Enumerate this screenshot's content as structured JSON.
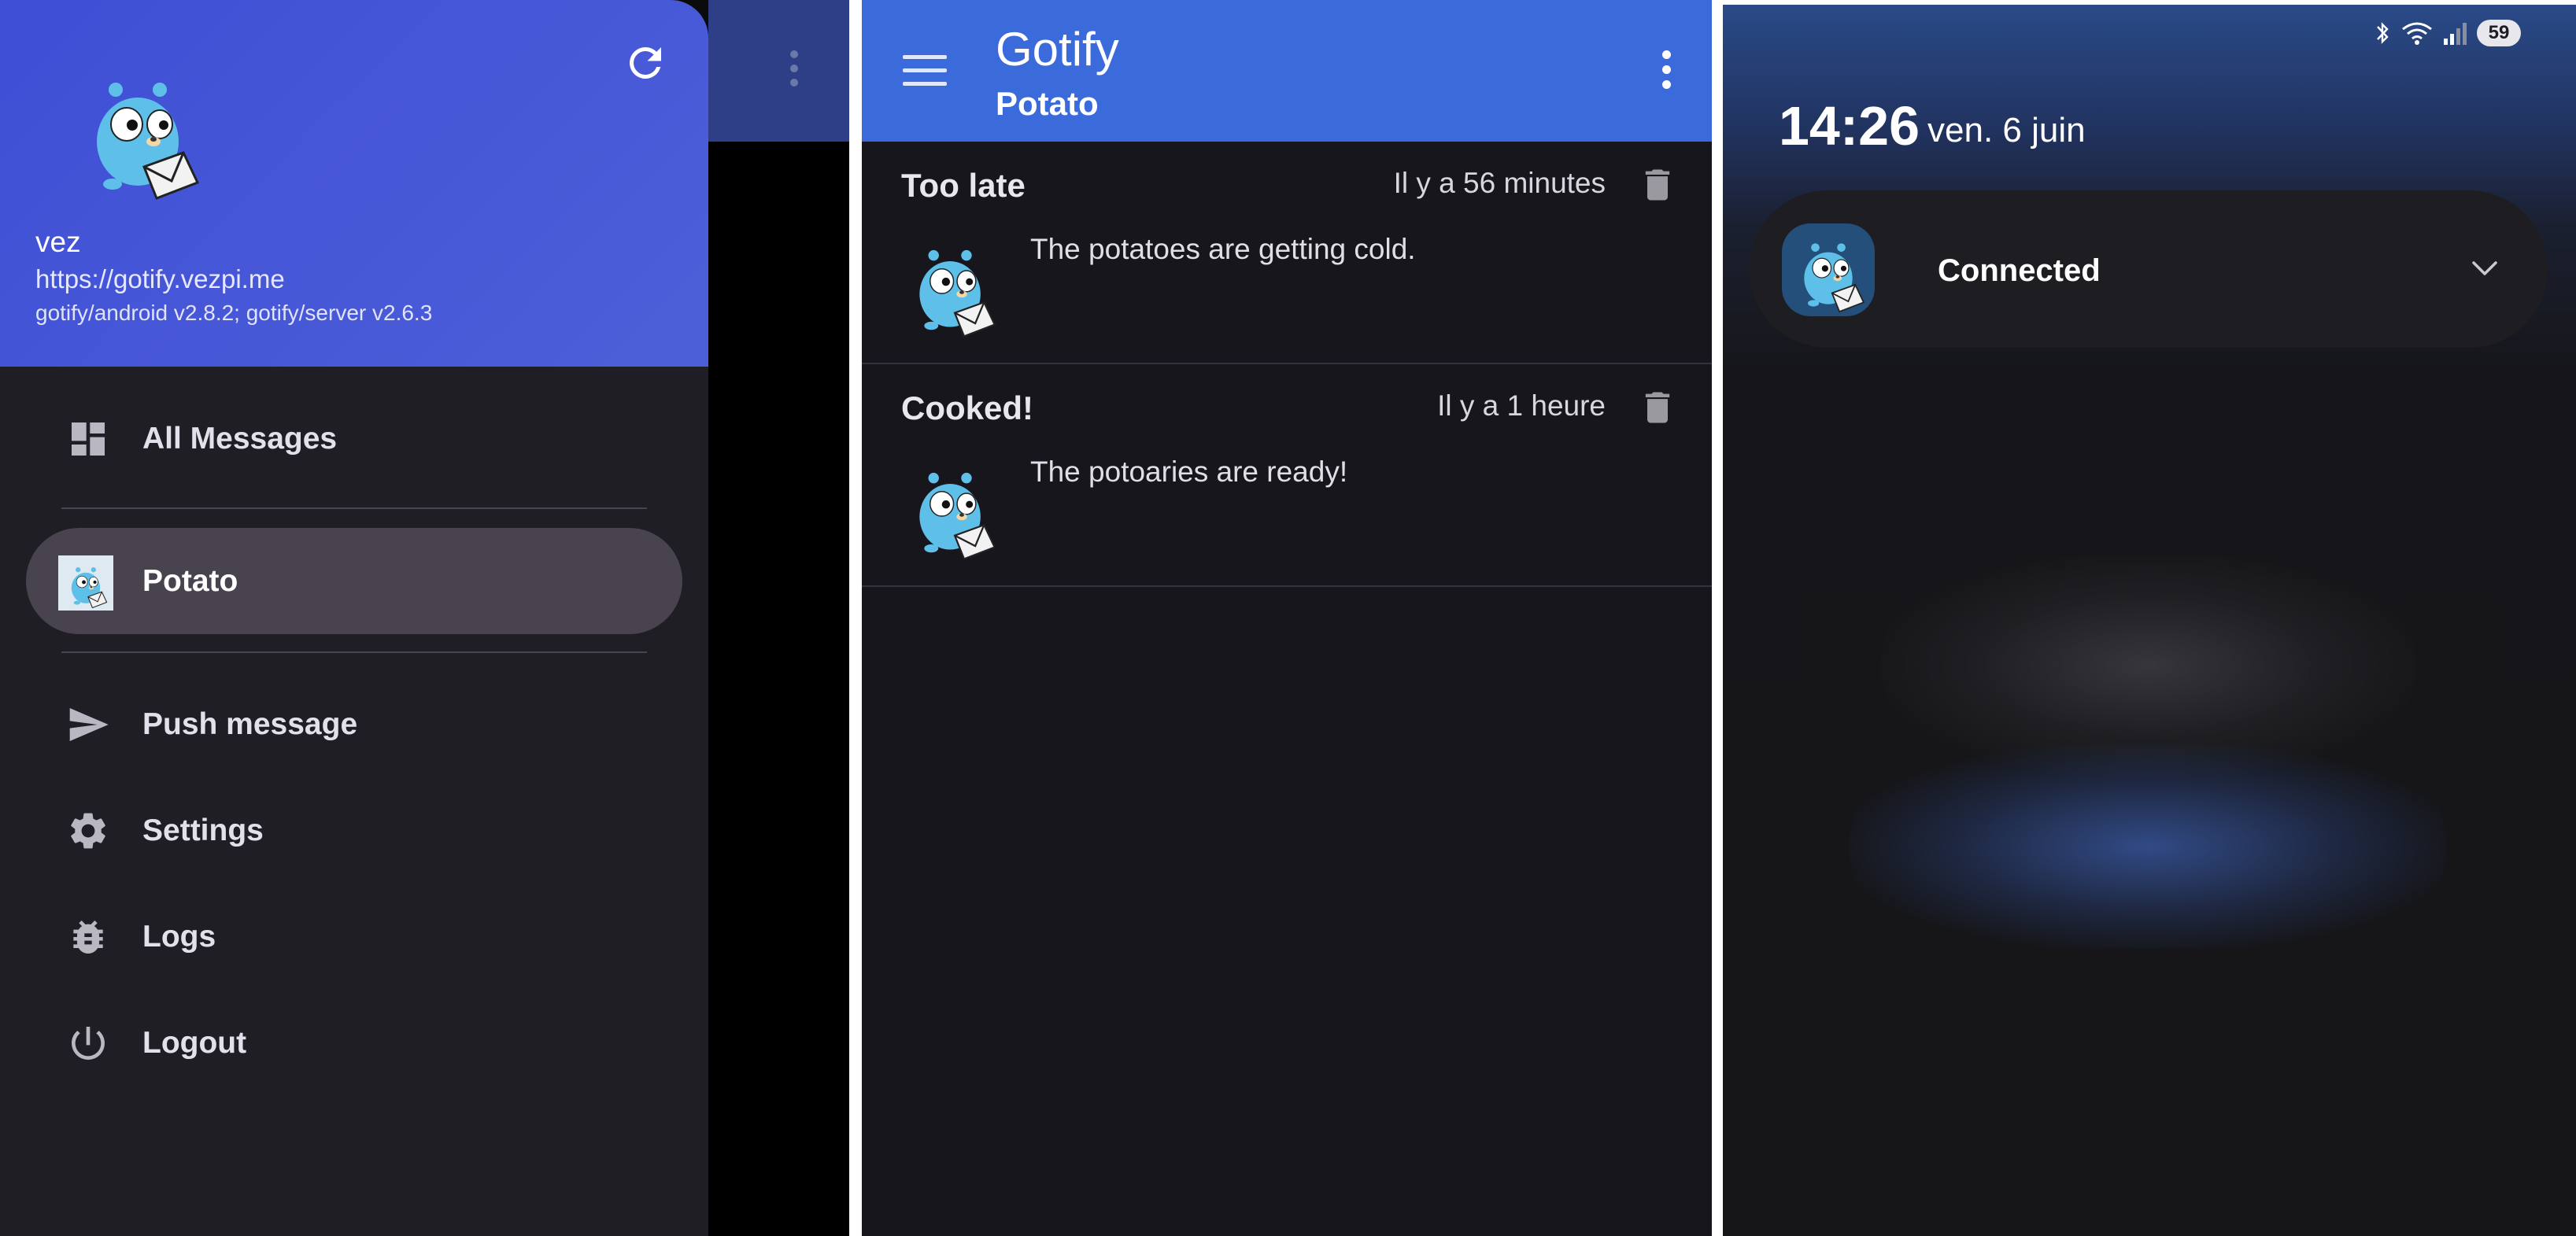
{
  "drawer": {
    "user": "vez",
    "server_url": "https://gotify.vezpi.me",
    "version": "gotify/android v2.8.2; gotify/server v2.6.3",
    "items": [
      {
        "label": "All Messages",
        "icon": "dashboard-icon"
      },
      {
        "label": "Potato",
        "icon": "gopher-app-icon",
        "active": true
      },
      {
        "label": "Push message",
        "icon": "send-icon"
      },
      {
        "label": "Settings",
        "icon": "gear-icon"
      },
      {
        "label": "Logs",
        "icon": "bug-icon"
      },
      {
        "label": "Logout",
        "icon": "power-icon"
      }
    ]
  },
  "app": {
    "title": "Gotify",
    "subtitle": "Potato",
    "messages": [
      {
        "title": "Too late",
        "date": "Il y a 56 minutes",
        "body": "The potatoes are getting cold."
      },
      {
        "title": "Cooked!",
        "date": "Il y a 1 heure",
        "body": "The potoaries are ready!"
      }
    ]
  },
  "lockscreen": {
    "battery": "59",
    "time": "14:26",
    "date": "ven. 6 juin",
    "notification": "Connected"
  },
  "colors": {
    "drawer_header": "#4354d6",
    "appbar": "#3b6bdb",
    "background_dark": "#17161d",
    "active_item": "#48434f"
  }
}
